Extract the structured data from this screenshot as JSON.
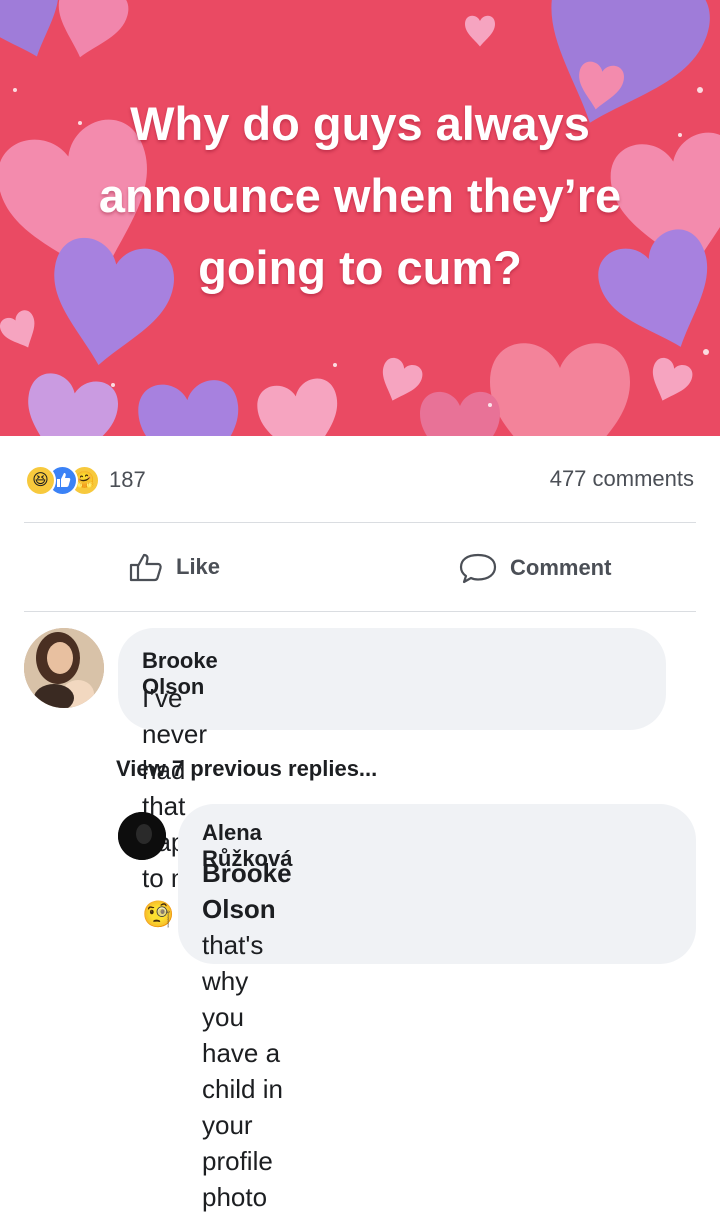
{
  "post": {
    "image_text": "Why do guys always announce when they’re going to cum?",
    "colors": {
      "banner": "#ea4a63",
      "heart_pink": "#f48fb1",
      "heart_purple": "#9b7fe0",
      "heart_lavender": "#c9a0e8"
    }
  },
  "stats": {
    "reaction_icons": [
      "haha-reaction-icon",
      "like-reaction-icon",
      "care-reaction-icon"
    ],
    "reaction_count": "187",
    "comment_count": "477 comments"
  },
  "actions": {
    "like_label": "Like",
    "comment_label": "Comment"
  },
  "comments": [
    {
      "author": "Brooke Olson",
      "text": "I’ve never had that happen to me",
      "emoji": "🧐"
    }
  ],
  "view_replies": "View 7 previous replies...",
  "reply": {
    "author": "Alena Růžková",
    "mention": "Brooke Olson",
    "text_line1": " that's why you",
    "text_line2": "have a child in your profile photo"
  }
}
